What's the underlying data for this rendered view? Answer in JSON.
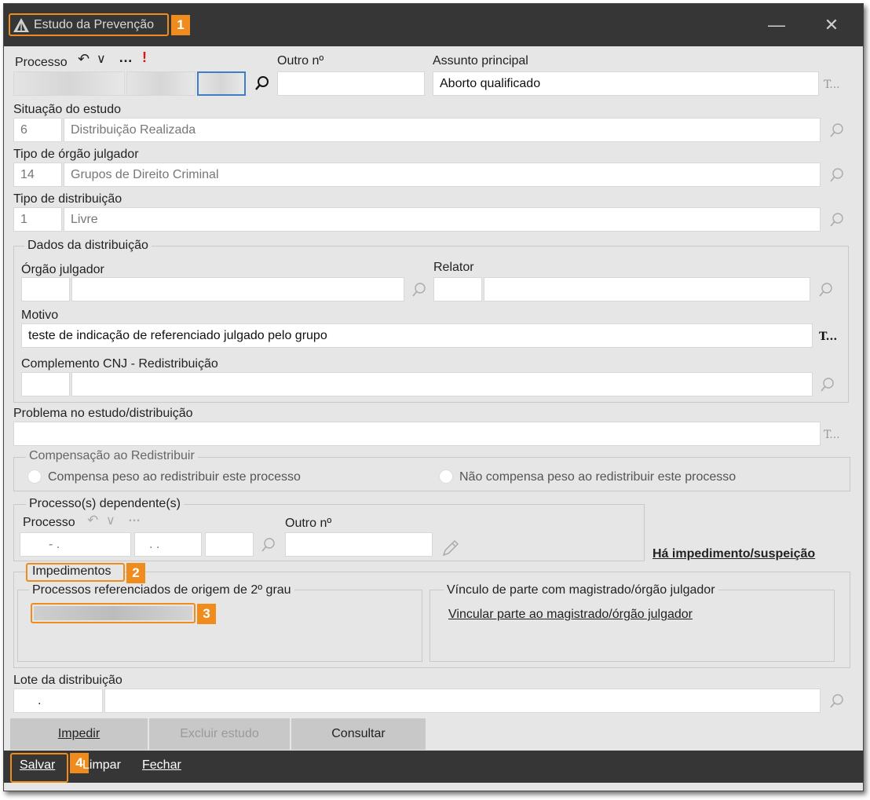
{
  "window": {
    "title": "Estudo da Prevenção",
    "minimize_glyph": "—",
    "close_glyph": "✕"
  },
  "callouts": [
    "1",
    "2",
    "3",
    "4"
  ],
  "processo": {
    "label": "Processo",
    "undo_glyph": "↶",
    "chevron_glyph": "∨",
    "more_glyph": "…",
    "alert_glyph": "!",
    "outro_label": "Outro nº",
    "outro_value": "",
    "assunto_label": "Assunto principal",
    "assunto_value": "Aborto qualificado",
    "assunto_more": "T..."
  },
  "situacao": {
    "label": "Situação do estudo",
    "code": "6",
    "value": "Distribuição Realizada"
  },
  "tipo_orgao": {
    "label": "Tipo de órgão julgador",
    "code": "14",
    "value": "Grupos de Direito Criminal"
  },
  "tipo_dist": {
    "label": "Tipo de distribuição",
    "code": "1",
    "value": "Livre"
  },
  "dados": {
    "title": "Dados da distribuição",
    "orgao_label": "Órgão julgador",
    "relator_label": "Relator",
    "motivo_label": "Motivo",
    "motivo_value": "teste de indicação de referenciado julgado pelo grupo",
    "motivo_more": "T...",
    "complemento_label": "Complemento CNJ - Redistribuição"
  },
  "problema": {
    "label": "Problema no estudo/distribuição",
    "more": "T..."
  },
  "compensacao": {
    "title": "Compensação ao Redistribuir",
    "option1": "Compensa peso ao redistribuir este processo",
    "option2": "Não compensa peso ao redistribuir este processo"
  },
  "dependentes": {
    "title": "Processo(s) dependente(s)",
    "processo_label": "Processo",
    "outro_label": "Outro nº",
    "f1": "- .",
    "f2": ". .",
    "impedimento_link": "Há impedimento/suspeição"
  },
  "impedimentos": {
    "title": "Impedimentos",
    "ref_title": "Processos referenciados de origem de 2º grau",
    "vinculo_title": "Vínculo de parte com magistrado/órgão julgador",
    "vinculo_link": "Vincular parte ao magistrado/órgão julgador"
  },
  "lote": {
    "label": "Lote da distribuição",
    "value": "."
  },
  "actions": {
    "impedir": "Impedir",
    "excluir": "Excluir estudo",
    "consultar": "Consultar"
  },
  "footer": {
    "salvar": "Salvar",
    "limpar": "Limpar",
    "fechar": "Fechar"
  }
}
